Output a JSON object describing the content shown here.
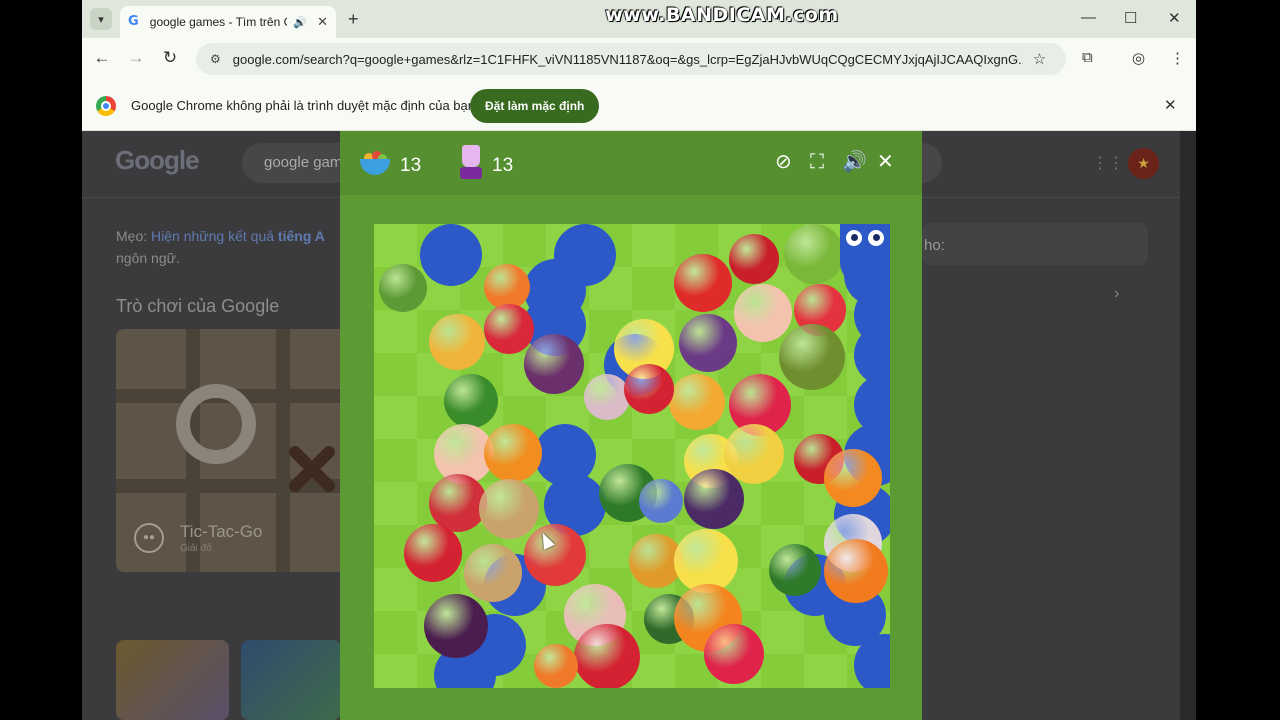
{
  "watermark": "www.BANDICAM.com",
  "tab": {
    "favicon": "G",
    "title": "google games - Tìm trên Google",
    "audio_icon": "speaker-icon",
    "close": "✕"
  },
  "toolbar": {
    "url": "google.com/search?q=google+games&rlz=1C1FHFK_viVN1185VN1187&oq=&gs_lcrp=EgZjaHJvbWUqCQgCECMYJxjqAjIJCAAQIxgnG..."
  },
  "infobar": {
    "message": "Google Chrome không phải là trình duyệt mặc định của bạn",
    "button": "Đặt làm mặc định"
  },
  "page": {
    "logo": "Google",
    "search_text": "google games",
    "tip_prefix": "Mẹo: ",
    "tip_link": "Hiện những kết quả ",
    "tip_bold": "tiếng A",
    "tip_suffix": "ngôn ngữ.",
    "games_heading": "Trò chơi của Google",
    "card_title": "Tic-Tac-Go",
    "card_sub": "Giải đố",
    "right_text": "ho:"
  },
  "game": {
    "fruits_eaten": "13",
    "smoothie_count": "13"
  },
  "colors": {
    "board_light": "#84cc3a",
    "board_tile": "#8fd445",
    "frame_green": "#5c9a33",
    "snake_blue": "#2c58c8"
  }
}
